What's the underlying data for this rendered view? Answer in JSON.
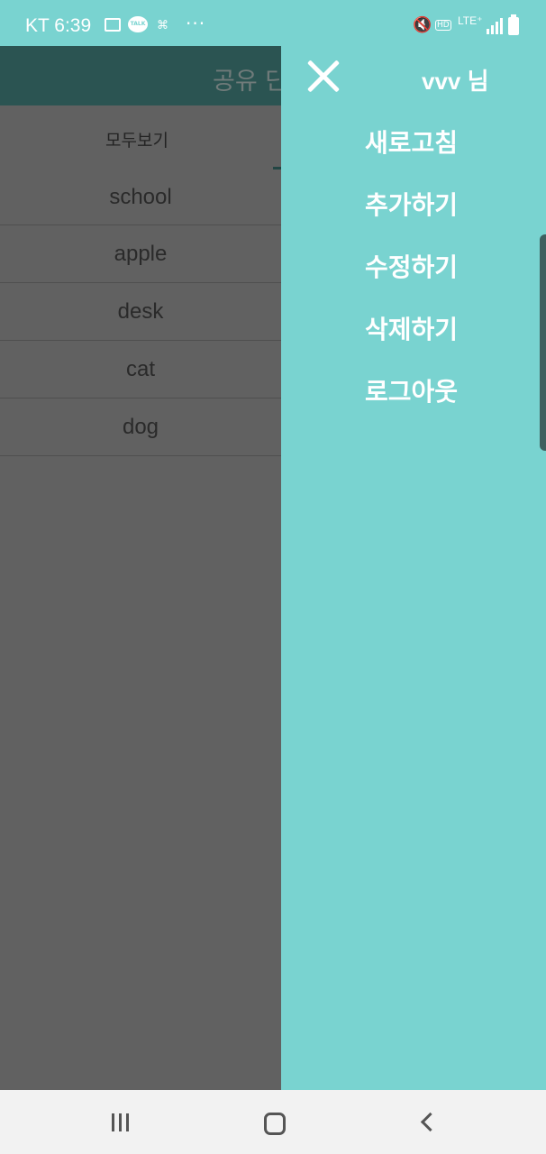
{
  "status_bar": {
    "carrier_time": "KT 6:39",
    "talk_label": "TALK",
    "dots": "···",
    "lte": "LTE⁺",
    "hd": "HD"
  },
  "app": {
    "title": "공유 단",
    "tab_all": "모두보기",
    "words": [
      "school",
      "apple",
      "desk",
      "cat",
      "dog"
    ]
  },
  "drawer": {
    "user_name": "vvv 님",
    "menu": [
      "새로고침",
      "추가하기",
      "수정하기",
      "삭제하기",
      "로그아웃"
    ]
  },
  "colors": {
    "accent": "#79d3d0",
    "app_bar": "#2b5452",
    "scrim": "#616161"
  }
}
